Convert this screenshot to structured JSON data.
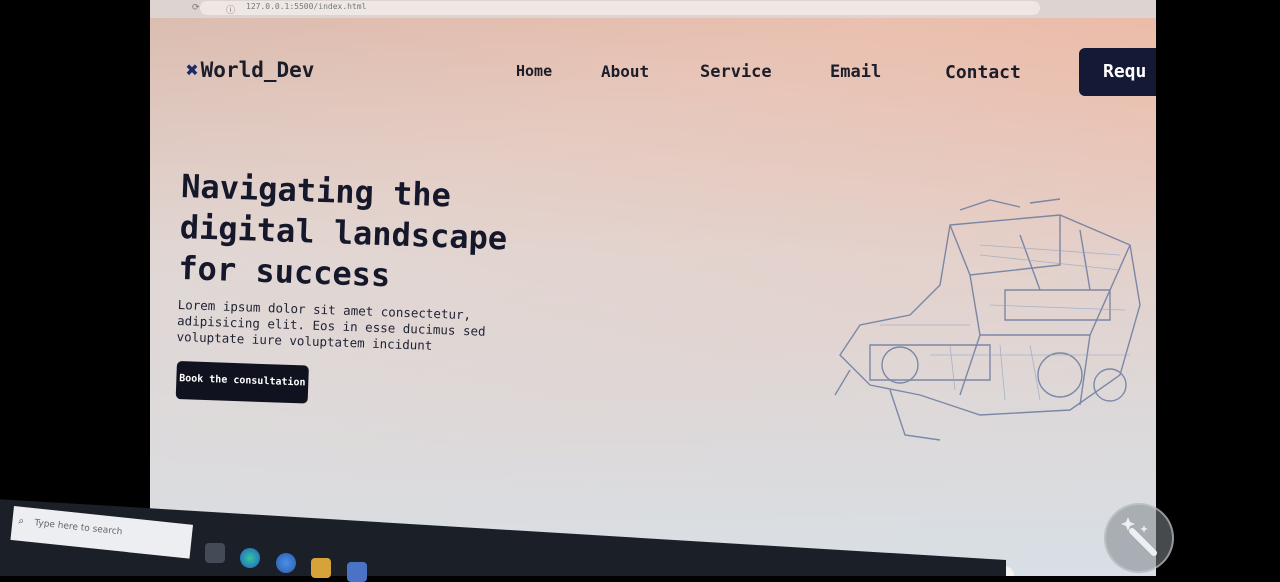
{
  "browser": {
    "url": "127.0.0.1:5500/index.html"
  },
  "site": {
    "logo_text": "World_Dev",
    "logo_icon": "x-mark-icon",
    "nav": {
      "home": "Home",
      "about": "About",
      "service": "Service",
      "email": "Email",
      "contact": "Contact"
    },
    "request_button": "Requ"
  },
  "hero": {
    "title": "Navigating the digital landscape for success",
    "text": "Lorem ipsum dolor sit amet consectetur, adipisicing elit. Eos in esse ducimus sed voluptate iure voluptatem incidunt",
    "cta_label": "Book the consultation",
    "illustration": "wireframe-machine-illustration"
  },
  "taskbar": {
    "search_placeholder": "Type here to search",
    "icons": [
      "windows-start-icon",
      "task-view-icon",
      "edge-icon",
      "chrome-icon",
      "file-explorer-icon",
      "store-icon"
    ]
  },
  "colors": {
    "dark_navy": "#141a35",
    "text_dark": "#15172a",
    "gradient_peach": "#f0b9a5",
    "gradient_light": "#d7e1e8"
  }
}
